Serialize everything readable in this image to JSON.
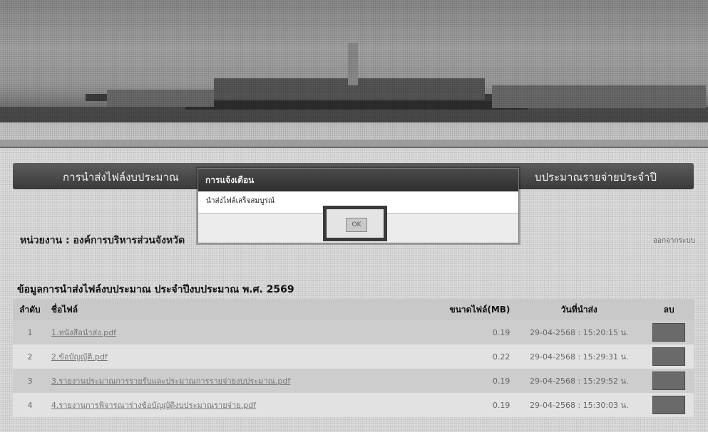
{
  "page": {
    "title_left": "การนำส่งไฟล์งบประมาณ",
    "title_right": "บประมาณรายจ่ายประจำปี",
    "agency_label": "หน่วยงาน : องค์การบริหารส่วนจังหวัด",
    "agency_right": "ออกจากระบบ",
    "section_heading": "ข้อมูลการนำส่งไฟล์งบประมาณ ประจำปีงบประมาณ พ.ศ. 2569"
  },
  "table": {
    "headers": {
      "no": "ลำดับ",
      "name": "ชื่อไฟล์",
      "size": "ขนาดไฟล์(MB)",
      "date": "วันที่นำส่ง",
      "delete": "ลบ"
    },
    "rows": [
      {
        "no": "1",
        "name": "1.หนังสือนำส่ง.pdf",
        "size": "0.19",
        "date": "29-04-2568 : 15:20:15 น."
      },
      {
        "no": "2",
        "name": "2.ข้อบัญญัติ.pdf",
        "size": "0.22",
        "date": "29-04-2568 : 15:29:31 น."
      },
      {
        "no": "3",
        "name": "3.รายงานประมาณการรายรับและประมาณการรายจ่ายงบประมาณ.pdf",
        "size": "0.19",
        "date": "29-04-2568 : 15:29:52 น."
      },
      {
        "no": "4",
        "name": "4.รายงานการพิจารณาร่างข้อบัญญัติงบประมาณรายจ่าย.pdf",
        "size": "0.19",
        "date": "29-04-2568 : 15:30:03 น."
      }
    ]
  },
  "modal": {
    "title": "การแจ้งเตือน",
    "message": "นำส่งไฟล์เสร็จสมบูรณ์",
    "ok_label": "OK"
  }
}
